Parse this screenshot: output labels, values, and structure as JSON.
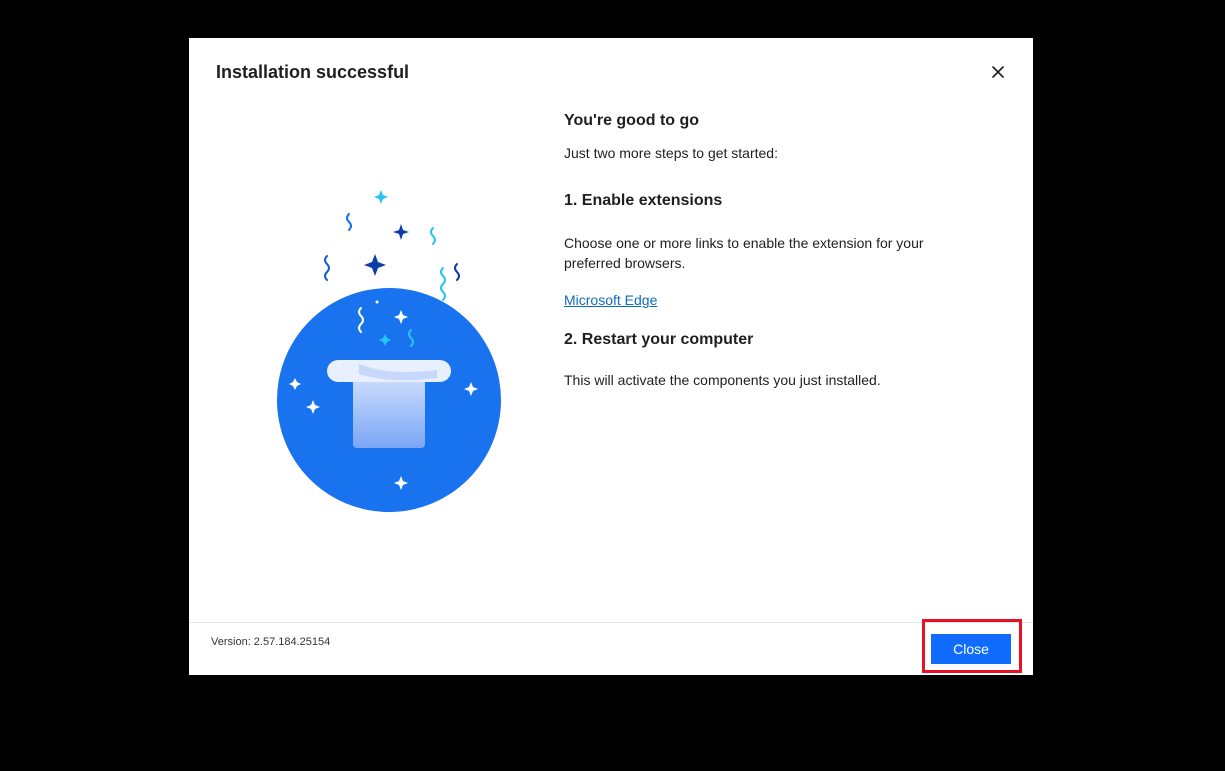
{
  "dialog": {
    "title": "Installation successful",
    "heading": "You're good to go",
    "subheading": "Just two more steps to get started:",
    "step1_title": "1. Enable extensions",
    "step1_text": "Choose one or more links to enable the extension for your preferred browsers.",
    "step1_link": "Microsoft Edge",
    "step2_title": "2. Restart your computer",
    "step2_text": "This will activate the components you just installed.",
    "version": "Version: 2.57.184.25154",
    "close_button_label": "Close",
    "close_icon": "close-icon",
    "illustration_icon": "magic-hat-icon"
  },
  "colors": {
    "accent": "#0f6cff",
    "link": "#0f6cbd",
    "highlight": "#e81123",
    "circle": "#1a73ee",
    "backdrop": "#000000"
  }
}
